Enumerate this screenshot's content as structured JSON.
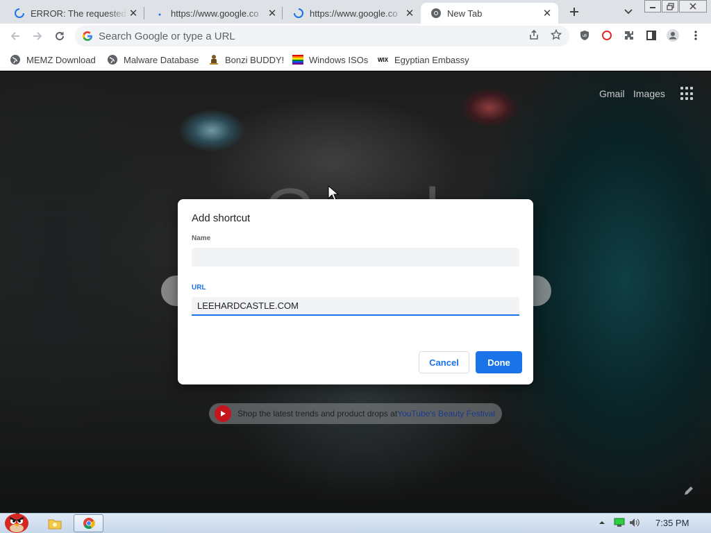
{
  "tabs": [
    {
      "title": "ERROR: The requested",
      "state": "loading"
    },
    {
      "title": "https://www.google.co",
      "state": "dot"
    },
    {
      "title": "https://www.google.co",
      "state": "loading"
    },
    {
      "title": "New Tab",
      "state": "active"
    }
  ],
  "toolbar": {
    "omnibox_placeholder": "Search Google or type a URL"
  },
  "bookmarks": [
    {
      "label": "MEMZ Download",
      "icon": "globe-icon"
    },
    {
      "label": "Malware Database",
      "icon": "globe-icon"
    },
    {
      "label": "Bonzi BUDDY!",
      "icon": "bonzi-icon"
    },
    {
      "label": "Windows ISOs",
      "icon": "rainbow-flag-icon"
    },
    {
      "label": "Egyptian Embassy",
      "icon": "wix-icon"
    }
  ],
  "ntp": {
    "gmail_link": "Gmail",
    "images_link": "Images",
    "promo_text": "Shop the latest trends and product drops at ",
    "promo_link": "YouTube's Beauty Festival"
  },
  "dialog": {
    "title": "Add shortcut",
    "name_label": "Name",
    "name_value": "",
    "url_label": "URL",
    "url_value": "LEEHARDCASTLE.COM",
    "cancel_label": "Cancel",
    "done_label": "Done"
  },
  "taskbar": {
    "clock": "7:35 PM"
  },
  "colors": {
    "accent": "#1a73e8",
    "tabstrip": "#dee1e6"
  }
}
